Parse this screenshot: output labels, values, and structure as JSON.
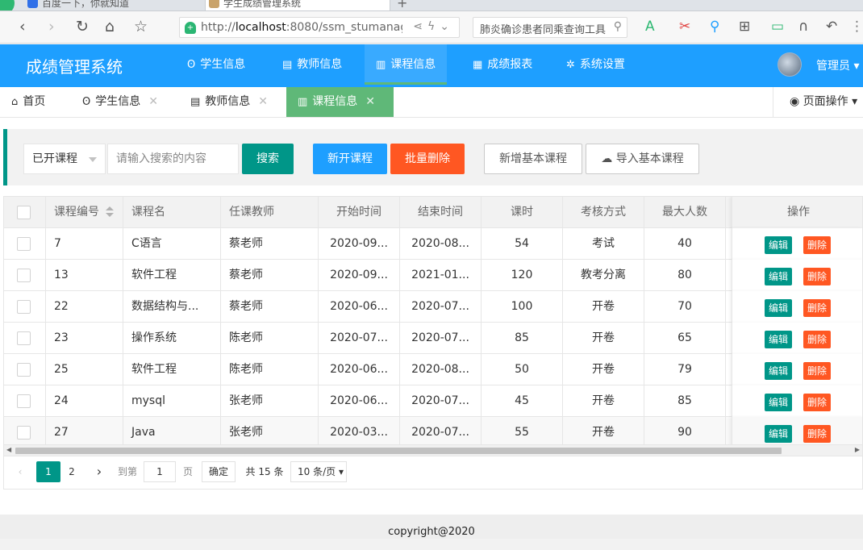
{
  "browser": {
    "tabs": [
      {
        "title": "百度一下，你就知道"
      },
      {
        "title": "学生成绩管理系统"
      }
    ],
    "url_prefix": "http://",
    "url_host": "localhost",
    "url_rest": ":8080/ssm_stumanage",
    "search_text": "肺炎确诊患者同乘查询工具"
  },
  "app": {
    "title": "成绩管理系统",
    "nav": [
      {
        "label": "学生信息",
        "icon": "users-icon"
      },
      {
        "label": "教师信息",
        "icon": "clipboard-icon"
      },
      {
        "label": "课程信息",
        "icon": "book-icon"
      },
      {
        "label": "成绩报表",
        "icon": "table-icon"
      },
      {
        "label": "系统设置",
        "icon": "gear-icon"
      }
    ],
    "user": "管理员",
    "accent": "#1E9FFF"
  },
  "page_tabs": [
    {
      "label": "首页",
      "icon": "home-icon"
    },
    {
      "label": "学生信息",
      "icon": "users-icon"
    },
    {
      "label": "教师信息",
      "icon": "clipboard-icon"
    },
    {
      "label": "课程信息",
      "icon": "book-icon"
    }
  ],
  "page_ops": "页面操作",
  "toolbar": {
    "filter_value": "已开课程",
    "search_placeholder": "请输入搜索的内容",
    "search_btn": "搜索",
    "new_btn": "新开课程",
    "batch_delete_btn": "批量删除",
    "add_basic_btn": "新增基本课程",
    "import_basic_btn": "导入基本课程"
  },
  "table": {
    "headers": [
      "课程编号",
      "课程名",
      "任课教师",
      "开始时间",
      "结束时间",
      "课时",
      "考核方式",
      "最大人数",
      "操作"
    ],
    "edit_label": "编辑",
    "delete_label": "删除",
    "rows": [
      {
        "id": "7",
        "name": "C语言",
        "teacher": "蔡老师",
        "start": "2020-09...",
        "end": "2020-08...",
        "hours": "54",
        "exam": "考试",
        "max": "40"
      },
      {
        "id": "13",
        "name": "软件工程",
        "teacher": "蔡老师",
        "start": "2020-09...",
        "end": "2021-01...",
        "hours": "120",
        "exam": "教考分离",
        "max": "80"
      },
      {
        "id": "22",
        "name": "数据结构与...",
        "teacher": "蔡老师",
        "start": "2020-06...",
        "end": "2020-07...",
        "hours": "100",
        "exam": "开卷",
        "max": "70"
      },
      {
        "id": "23",
        "name": "操作系统",
        "teacher": "陈老师",
        "start": "2020-07...",
        "end": "2020-07...",
        "hours": "85",
        "exam": "开卷",
        "max": "65"
      },
      {
        "id": "25",
        "name": "软件工程",
        "teacher": "陈老师",
        "start": "2020-06...",
        "end": "2020-08...",
        "hours": "50",
        "exam": "开卷",
        "max": "79"
      },
      {
        "id": "24",
        "name": "mysql",
        "teacher": "张老师",
        "start": "2020-06...",
        "end": "2020-07...",
        "hours": "45",
        "exam": "开卷",
        "max": "85"
      },
      {
        "id": "27",
        "name": "Java",
        "teacher": "张老师",
        "start": "2020-03...",
        "end": "2020-07...",
        "hours": "55",
        "exam": "开卷",
        "max": "90"
      }
    ]
  },
  "pager": {
    "pages": [
      "1",
      "2"
    ],
    "current": "1",
    "goto_label": "到第",
    "goto_value": "1",
    "page_unit": "页",
    "confirm": "确定",
    "total": "共 15 条",
    "page_size": "10 条/页"
  },
  "footer": "copyright@2020"
}
